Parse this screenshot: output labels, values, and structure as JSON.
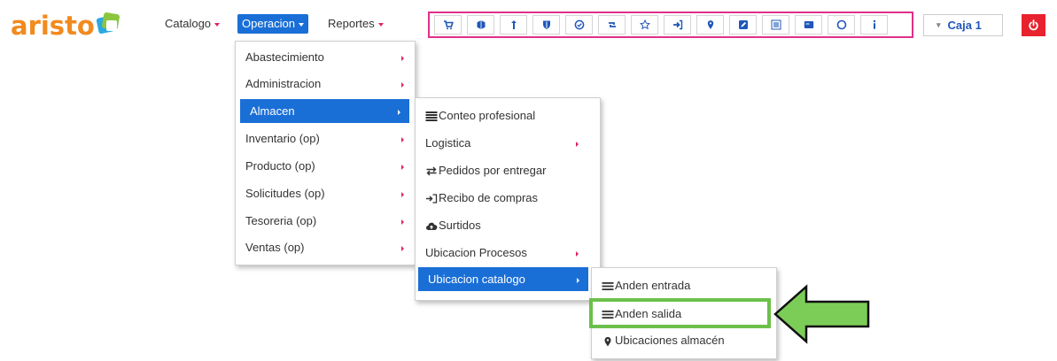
{
  "logo": {
    "text": "aristo",
    "icon": "aristo-badge-icon"
  },
  "nav": {
    "catalogo": "Catalogo",
    "operacion": "Operacion",
    "reportes": "Reportes"
  },
  "toolbar": {
    "buttons": [
      "cart-icon",
      "box-icon",
      "pin-up-icon",
      "shield-icon",
      "check-circle-icon",
      "retweet-icon",
      "star-icon",
      "sign-in-icon",
      "map-marker-icon",
      "edit-icon",
      "grid-icon",
      "card-icon",
      "circle-icon",
      "info-icon"
    ]
  },
  "caja": {
    "label": "Caja 1"
  },
  "power": {
    "icon": "power-icon",
    "color": "#e8222e"
  },
  "operacion_menu": {
    "items": [
      "Abastecimiento",
      "Administracion",
      "Almacen",
      "Inventario (op)",
      "Producto (op)",
      "Solicitudes (op)",
      "Tesoreria (op)",
      "Ventas (op)"
    ],
    "selected": "Almacen"
  },
  "almacen_menu": {
    "items": [
      {
        "label": "Conteo profesional",
        "icon": "list-icon"
      },
      {
        "label": "Logistica",
        "icon": ""
      },
      {
        "label": "Pedidos por entregar",
        "icon": "exchange-icon"
      },
      {
        "label": "Recibo de compras",
        "icon": "sign-in-icon"
      },
      {
        "label": "Surtidos",
        "icon": "cloud-upload-icon"
      },
      {
        "label": "Ubicacion Procesos",
        "icon": ""
      },
      {
        "label": "Ubicacion catalogo",
        "icon": ""
      }
    ],
    "selected": "Ubicacion catalogo"
  },
  "ubicacion_menu": {
    "items": [
      {
        "label": "Anden entrada",
        "icon": "list-icon"
      },
      {
        "label": "Anden salida",
        "icon": "list-icon"
      },
      {
        "label": "Ubicaciones almacén",
        "icon": "map-marker-icon"
      }
    ],
    "highlighted": "Anden salida"
  },
  "colors": {
    "accent": "#1a6fd6",
    "toolbar_border": "#e0308a",
    "highlight": "#6cc04a",
    "logo": "#f28a1e"
  }
}
